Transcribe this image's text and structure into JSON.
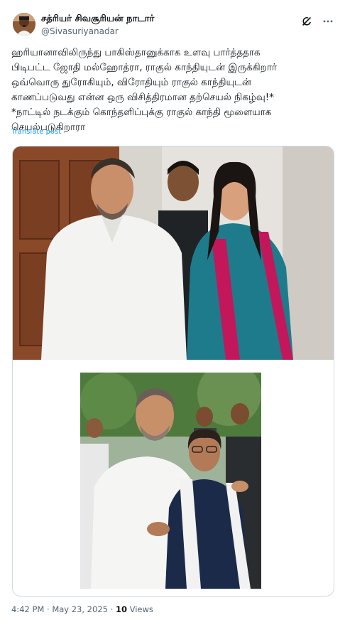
{
  "author": {
    "display_name": "சத்ரியர் சிவசூரியன் நாடார்",
    "handle": "@Sivasuriyanadar",
    "avatar_icon": "profile-avatar"
  },
  "header_icons": [
    "grok-icon",
    "more-icon"
  ],
  "tweet": {
    "lines": [
      "ஹரியானாவிலிருந்து பாகிஸ்தானுக்காக உளவு பார்த்ததாக",
      "பிடிபட்ட ஜோதி மல்ஹோத்ரா, ராகுல் காந்தியுடன் இருக்கிறார்",
      "ஒவ்வொரு துரோகியும், விரோதியும் ராகுல் காந்தியுடன்",
      "காணப்படுவது என்ன ஒரு விசித்திரமான தற்செயல் நிகழ்வு!*",
      "*நாட்டில் நடக்கும் கொந்தளிப்புக்கு ராகுல் காந்தி மூளையாக",
      "செயல்படுகிறாரா"
    ],
    "translate_label": "Translate post"
  },
  "footer": {
    "time": "4:42 PM",
    "separator1": " · ",
    "date": "May 23, 2025",
    "separator2": " · ",
    "views_count": "10",
    "views_label": " Views"
  },
  "colors": {
    "link_blue": "#1d9bf0",
    "muted": "#536471",
    "border": "#cfd9de"
  }
}
